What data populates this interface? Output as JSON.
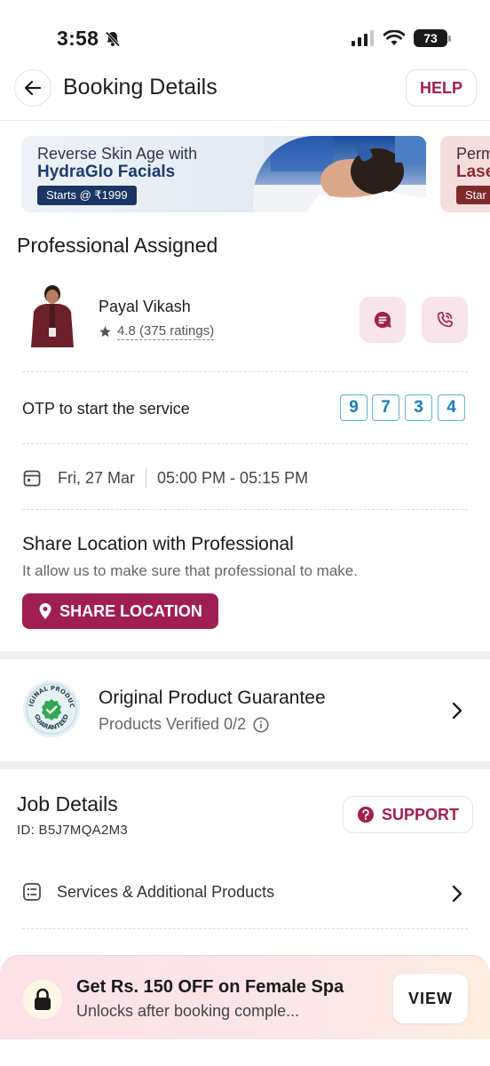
{
  "status_bar": {
    "time": "3:58",
    "battery": "73"
  },
  "header": {
    "title": "Booking Details",
    "help_label": "HELP"
  },
  "banners": [
    {
      "line1": "Reverse Skin Age with",
      "line2": "HydraGlo Facials",
      "tag": "Starts @ ₹1999"
    },
    {
      "line1": "Perm",
      "line2": "Lase",
      "tag": "Star"
    }
  ],
  "professional": {
    "section_title": "Professional Assigned",
    "name": "Payal Vikash",
    "rating": "4.8 (375 ratings)"
  },
  "otp": {
    "label": "OTP to start the service",
    "digits": [
      "9",
      "7",
      "3",
      "4"
    ]
  },
  "schedule": {
    "date": "Fri, 27 Mar",
    "time": "05:00 PM - 05:15 PM"
  },
  "share_location": {
    "title": "Share Location with Professional",
    "subtitle": "It allow us to make sure that professional to make.",
    "button_label": "SHARE LOCATION"
  },
  "guarantee": {
    "title": "Original Product Guarantee",
    "subtitle": "Products Verified 0/2",
    "badge_text_top": "ORIGINAL PRODUCTS",
    "badge_text_bottom": "GUARANTEED"
  },
  "job": {
    "title": "Job Details",
    "id": "ID: B5J7MQA2M3",
    "support_label": "SUPPORT",
    "services_label": "Services & Additional Products"
  },
  "offer": {
    "title": "Get Rs. 150 OFF on Female Spa",
    "subtitle": "Unlocks after booking comple...",
    "button_label": "VIEW"
  },
  "colors": {
    "accent": "#a01f52",
    "otp_blue": "#1b7fb6",
    "banner_navy": "#1b3565"
  }
}
